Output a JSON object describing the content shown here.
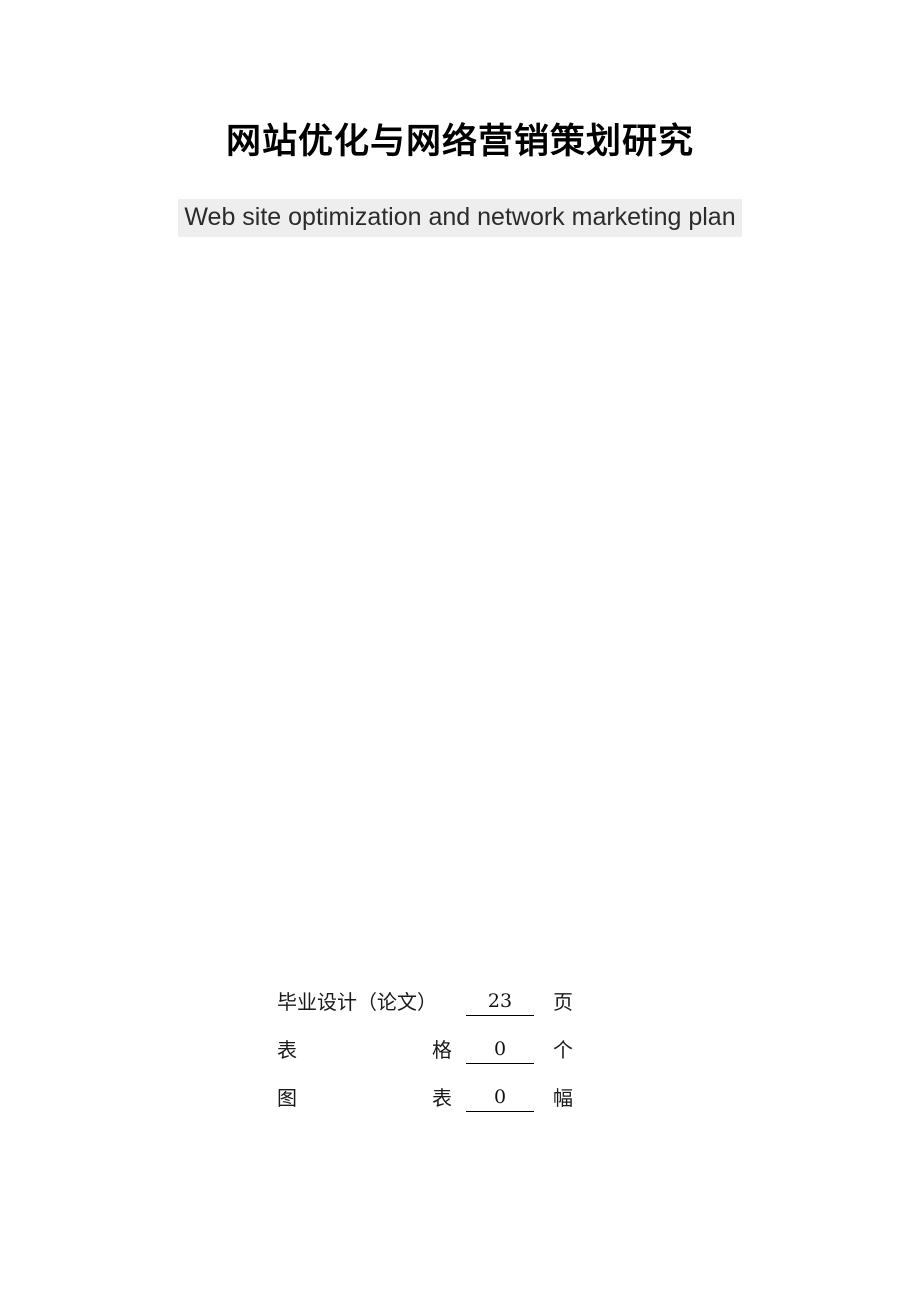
{
  "document": {
    "title_cn": "网站优化与网络营销策划研究",
    "subtitle_en": "Web site optimization and network marketing plan",
    "subtitle_highlight_color": "#eeeeee",
    "text_color": "#000000"
  },
  "statistics": {
    "rows": [
      {
        "label_left": "毕业设计（论文）",
        "label_right": "",
        "value": "23",
        "unit": "页"
      },
      {
        "label_left": "表",
        "label_right": "格",
        "value": "0",
        "unit": "个"
      },
      {
        "label_left": "图",
        "label_right": "表",
        "value": "0",
        "unit": "幅"
      }
    ]
  }
}
